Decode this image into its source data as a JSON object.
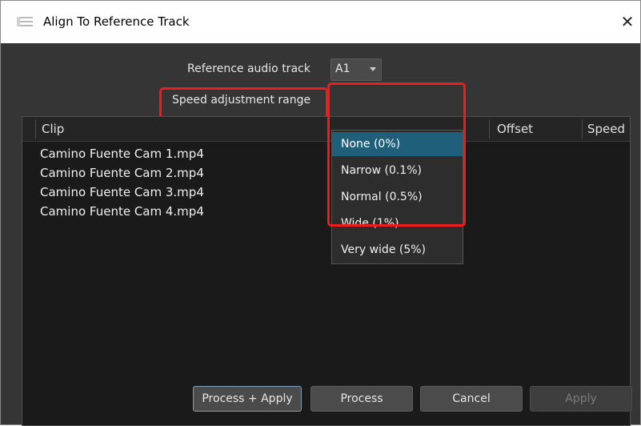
{
  "window": {
    "title": "Align To Reference Track",
    "close_glyph": "✕",
    "icon": "list-icon"
  },
  "reference": {
    "label": "Reference audio track",
    "value": "A1"
  },
  "speed": {
    "label": "Speed adjustment range",
    "options": [
      "None (0%)",
      "Narrow (0.1%)",
      "Normal (0.5%)",
      "Wide (1%)",
      "Very wide (5%)"
    ],
    "selected_index": 0
  },
  "table": {
    "columns": [
      "Clip",
      "Offset",
      "Speed"
    ],
    "rows": [
      "Camino Fuente Cam 1.mp4",
      "Camino Fuente Cam 2.mp4",
      "Camino Fuente Cam 3.mp4",
      "Camino Fuente Cam 4.mp4"
    ]
  },
  "buttons": {
    "process_apply": "Process + Apply",
    "process": "Process",
    "cancel": "Cancel",
    "apply": "Apply"
  },
  "colors": {
    "highlight": "#ee1c1c",
    "selection": "#1f5f7a",
    "background": "#353535"
  }
}
